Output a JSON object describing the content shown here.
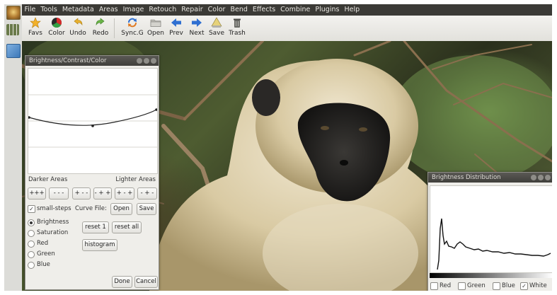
{
  "menu": [
    "File",
    "Tools",
    "Metadata",
    "Areas",
    "Image",
    "Retouch",
    "Repair",
    "Color",
    "Bend",
    "Effects",
    "Combine",
    "Plugins",
    "Help"
  ],
  "toolbar": [
    {
      "label": "Favs",
      "icon": "star-icon"
    },
    {
      "label": "Color",
      "icon": "color-wheel-icon"
    },
    {
      "label": "Undo",
      "icon": "undo-icon"
    },
    {
      "label": "Redo",
      "icon": "redo-icon"
    },
    {
      "label": "Sync.G",
      "icon": "sync-icon"
    },
    {
      "label": "Open",
      "icon": "folder-icon"
    },
    {
      "label": "Prev",
      "icon": "arrow-left-icon"
    },
    {
      "label": "Next",
      "icon": "arrow-right-icon"
    },
    {
      "label": "Save",
      "icon": "save-icon"
    },
    {
      "label": "Trash",
      "icon": "trash-icon"
    }
  ],
  "bcc_dialog": {
    "title": "Brightness/Contrast/Color",
    "darker_label": "Darker Areas",
    "lighter_label": "Lighter Areas",
    "shift_buttons": [
      "+++",
      "- - -",
      "+ - -",
      "- + +",
      "+ - +",
      "- + -"
    ],
    "small_steps_label": "small-steps",
    "curve_file_label": "Curve File:",
    "open_label": "Open",
    "save_label": "Save",
    "channels": [
      "Brightness",
      "Saturation",
      "Red",
      "Green",
      "Blue"
    ],
    "selected_channel": "Brightness",
    "reset1_label": "reset 1",
    "reset_all_label": "reset all",
    "histogram_label": "histogram",
    "done_label": "Done",
    "cancel_label": "Cancel"
  },
  "dist_dialog": {
    "title": "Brightness Distribution",
    "checks": [
      {
        "label": "Red",
        "checked": false
      },
      {
        "label": "Green",
        "checked": false
      },
      {
        "label": "Blue",
        "checked": false
      },
      {
        "label": "White",
        "checked": true
      }
    ]
  },
  "colors": {
    "menubar": "#3b3a36",
    "titlebar": "#4a4945",
    "accent_blue": "#2f6fd1"
  }
}
